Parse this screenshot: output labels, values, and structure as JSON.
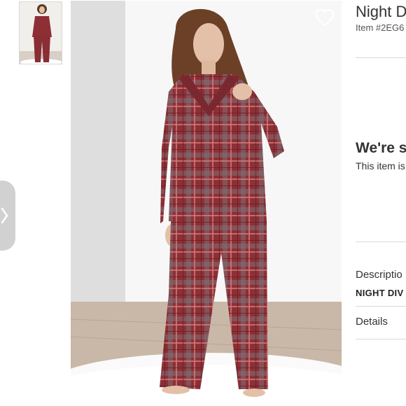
{
  "product": {
    "title": "Night D",
    "item_number": "Item #2EG6"
  },
  "availability": {
    "heading": "We're s",
    "message": "This item is"
  },
  "sections": {
    "description_label": "Descriptio",
    "brand": "NIGHT DIV",
    "details_label": "Details"
  },
  "icons": {
    "favorite": "heart-icon",
    "next": "chevron-right-icon"
  },
  "colors": {
    "plaid_base": "#8e2f36",
    "plaid_stripe": "#b9646a",
    "plaid_gray": "#7c6f74",
    "divider": "#d9d9d9"
  }
}
